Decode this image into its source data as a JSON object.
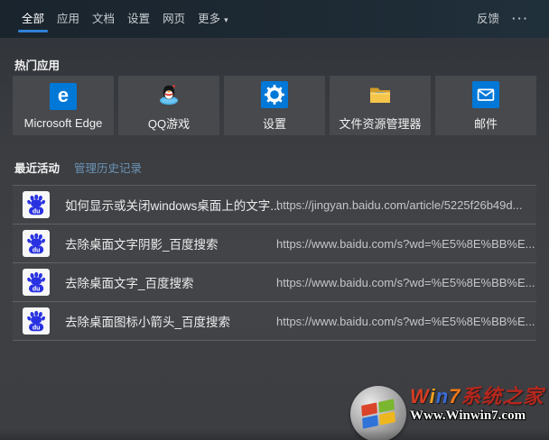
{
  "tabs": {
    "items": [
      {
        "label": "全部",
        "active": true
      },
      {
        "label": "应用",
        "active": false
      },
      {
        "label": "文档",
        "active": false
      },
      {
        "label": "设置",
        "active": false
      },
      {
        "label": "网页",
        "active": false
      },
      {
        "label": "更多",
        "active": false
      }
    ],
    "more_caret": "▾",
    "feedback_label": "反馈",
    "ellipsis": "···"
  },
  "popular": {
    "title": "热门应用",
    "tiles": [
      {
        "label": "Microsoft Edge",
        "icon": "edge-icon"
      },
      {
        "label": "QQ游戏",
        "icon": "qq-games-icon"
      },
      {
        "label": "设置",
        "icon": "settings-gear-icon"
      },
      {
        "label": "文件资源管理器",
        "icon": "file-explorer-folder-icon"
      },
      {
        "label": "邮件",
        "icon": "mail-envelope-icon"
      }
    ],
    "edge_letter": "e"
  },
  "recent": {
    "title": "最近活动",
    "manage_link": "管理历史记录",
    "items": [
      {
        "icon": "baidu-icon",
        "title": "如何显示或关闭windows桌面上的文字...",
        "url": "https://jingyan.baidu.com/article/5225f26b49d..."
      },
      {
        "icon": "baidu-icon",
        "title": "去除桌面文字阴影_百度搜索",
        "url": "https://www.baidu.com/s?wd=%E5%8E%BB%E..."
      },
      {
        "icon": "baidu-icon",
        "title": "去除桌面文字_百度搜索",
        "url": "https://www.baidu.com/s?wd=%E5%8E%BB%E..."
      },
      {
        "icon": "baidu-icon",
        "title": "去除桌面图标小箭头_百度搜索",
        "url": "https://www.baidu.com/s?wd=%E5%8E%BB%E..."
      }
    ],
    "baidu_du": "du"
  },
  "watermark": {
    "letters": [
      {
        "ch": "W"
      },
      {
        "ch": "i"
      },
      {
        "ch": "n"
      },
      {
        "ch": "7"
      }
    ],
    "brand_cn": "系统之家",
    "site_url": "Www.Winwin7.com"
  },
  "colors": {
    "accent_blue": "#0078d7",
    "tab_underline": "#2e80d6",
    "link_blue": "#6b93b5",
    "baidu_blue": "#2932e1",
    "folder_yellow": "#f3c33f",
    "header_bg": "#1d2933",
    "body_bg": "#3c3e42",
    "tile_bg": "#47494d"
  }
}
